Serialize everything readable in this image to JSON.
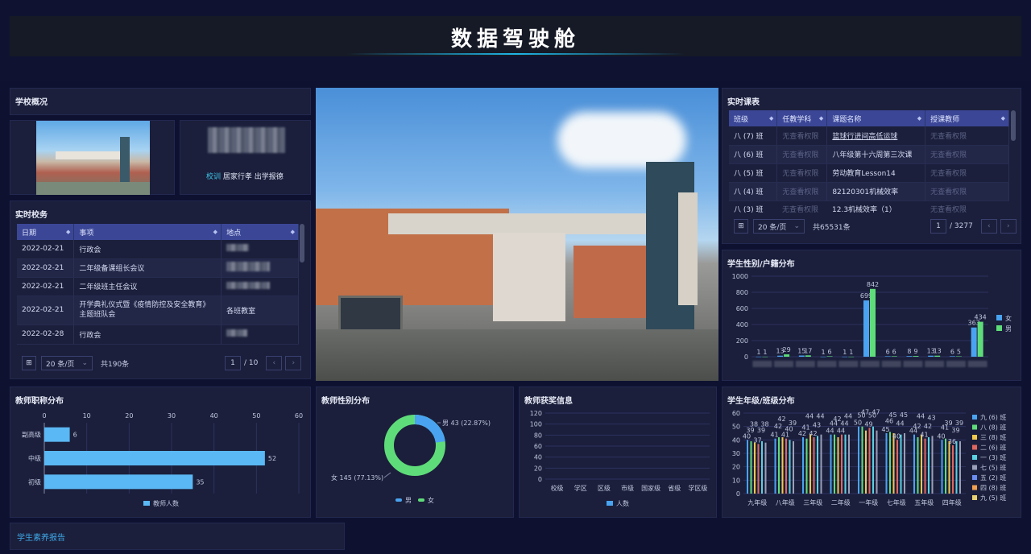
{
  "header": {
    "title": "数据驾驶舱"
  },
  "school": {
    "title": "学校概况",
    "motto_label": "校训",
    "motto_text": "居家行孝 出学报德"
  },
  "tasks": {
    "title": "实时校务",
    "columns": [
      "日期",
      "事项",
      "地点"
    ],
    "rows": [
      {
        "date": "2022-02-21",
        "item": "行政会",
        "place": ""
      },
      {
        "date": "2022-02-21",
        "item": "二年级备课组长会议",
        "place": ""
      },
      {
        "date": "2022-02-21",
        "item": "二年级班主任会议",
        "place": ""
      },
      {
        "date": "2022-02-21",
        "item": "开学典礼仪式暨《疫情防控及安全教育》主题班队会",
        "place": "各班教室"
      },
      {
        "date": "2022-02-28",
        "item": "行政会",
        "place": ""
      }
    ],
    "page_size": "20 条/页",
    "total": "共190条",
    "page": "1",
    "pages": "/ 10"
  },
  "schedule": {
    "title": "实时课表",
    "columns": [
      "班级",
      "任教学科",
      "课题名称",
      "授课教师"
    ],
    "rows": [
      {
        "class": "八 (7) 班",
        "subject": "无查看权限",
        "topic": "篮球行进间高低运球",
        "teacher": "无查看权限"
      },
      {
        "class": "八 (6) 班",
        "subject": "无查看权限",
        "topic": "八年级第十六周第三次课",
        "teacher": "无查看权限"
      },
      {
        "class": "八 (5) 班",
        "subject": "无查看权限",
        "topic": "劳动教育Lesson14",
        "teacher": "无查看权限"
      },
      {
        "class": "八 (4) 班",
        "subject": "无查看权限",
        "topic": "82120301机械效率",
        "teacher": "无查看权限"
      },
      {
        "class": "八 (3) 班",
        "subject": "无查看权限",
        "topic": "12.3机械效率（1）",
        "teacher": "无查看权限"
      }
    ],
    "page_size": "20 条/页",
    "total": "共65531条",
    "page": "1",
    "pages": "/ 3277"
  },
  "gender_household": {
    "title": "学生性别/户籍分布",
    "legend": [
      "女",
      "男"
    ],
    "colors": [
      "#4aa3f0",
      "#5fdc7a"
    ],
    "yticks": [
      "1000",
      "800",
      "600",
      "400",
      "200",
      "0"
    ],
    "groups": [
      {
        "f": 1,
        "m": 1
      },
      {
        "f": 13,
        "m": 29
      },
      {
        "f": 15,
        "m": 17
      },
      {
        "f": 1,
        "m": 6
      },
      {
        "f": 1,
        "m": 1
      },
      {
        "f": 699,
        "m": 842
      },
      {
        "f": 6,
        "m": 6
      },
      {
        "f": 8,
        "m": 9
      },
      {
        "f": 13,
        "m": 13
      },
      {
        "f": 6,
        "m": 5
      },
      {
        "f": 363,
        "m": 434
      }
    ]
  },
  "teacher_title": {
    "title": "教师职称分布",
    "legend": "教师人数",
    "xticks": [
      "0",
      "10",
      "20",
      "30",
      "40",
      "50",
      "60"
    ],
    "bars": [
      {
        "label": "副高级",
        "value": 6
      },
      {
        "label": "中级",
        "value": 52
      },
      {
        "label": "初级",
        "value": 35
      }
    ]
  },
  "teacher_gender": {
    "title": "教师性别分布",
    "male_label": "男 43 (22.87%)",
    "female_label": "女 145 (77.13%)",
    "legend_male": "男",
    "legend_female": "女",
    "male_value": 43,
    "female_value": 145
  },
  "teacher_award": {
    "title": "教师获奖信息",
    "legend": "人数",
    "yticks": [
      "120",
      "100",
      "80",
      "60",
      "40",
      "20",
      "0"
    ],
    "categories": [
      "校级",
      "学区",
      "区级",
      "市级",
      "国家级",
      "省级",
      "学区级"
    ]
  },
  "grade_class": {
    "title": "学生年级/班级分布",
    "categories": [
      "九年级",
      "八年级",
      "三年级",
      "二年级",
      "一年级",
      "七年级",
      "五年级",
      "四年级"
    ],
    "yticks": [
      "60",
      "50",
      "40",
      "30",
      "20",
      "10",
      "0"
    ],
    "legend": [
      "九 (6) 班",
      "八 (8) 班",
      "三 (8) 班",
      "二 (6) 班",
      "一 (3) 班",
      "七 (5) 班",
      "五 (2) 班",
      "四 (8) 班",
      "九 (5) 班"
    ],
    "legend_colors": [
      "#4aa3f0",
      "#5fdc7a",
      "#f2c94c",
      "#e0675f",
      "#5ad1e0",
      "#9aa0b8",
      "#6b8cf0",
      "#f0a050",
      "#e8d070"
    ],
    "groups": [
      [
        40,
        39,
        38,
        37,
        39,
        38
      ],
      [
        41,
        42,
        42,
        41,
        40,
        39
      ],
      [
        42,
        41,
        44,
        42,
        43,
        44
      ],
      [
        44,
        44,
        42,
        44,
        44,
        44
      ],
      [
        50,
        50,
        47,
        49,
        50,
        47
      ],
      [
        45,
        46,
        45,
        40,
        44,
        45
      ],
      [
        44,
        42,
        44,
        41,
        42,
        43
      ],
      [
        40,
        41,
        39,
        36,
        39,
        39
      ]
    ]
  },
  "report": {
    "label": "学生素养报告"
  }
}
